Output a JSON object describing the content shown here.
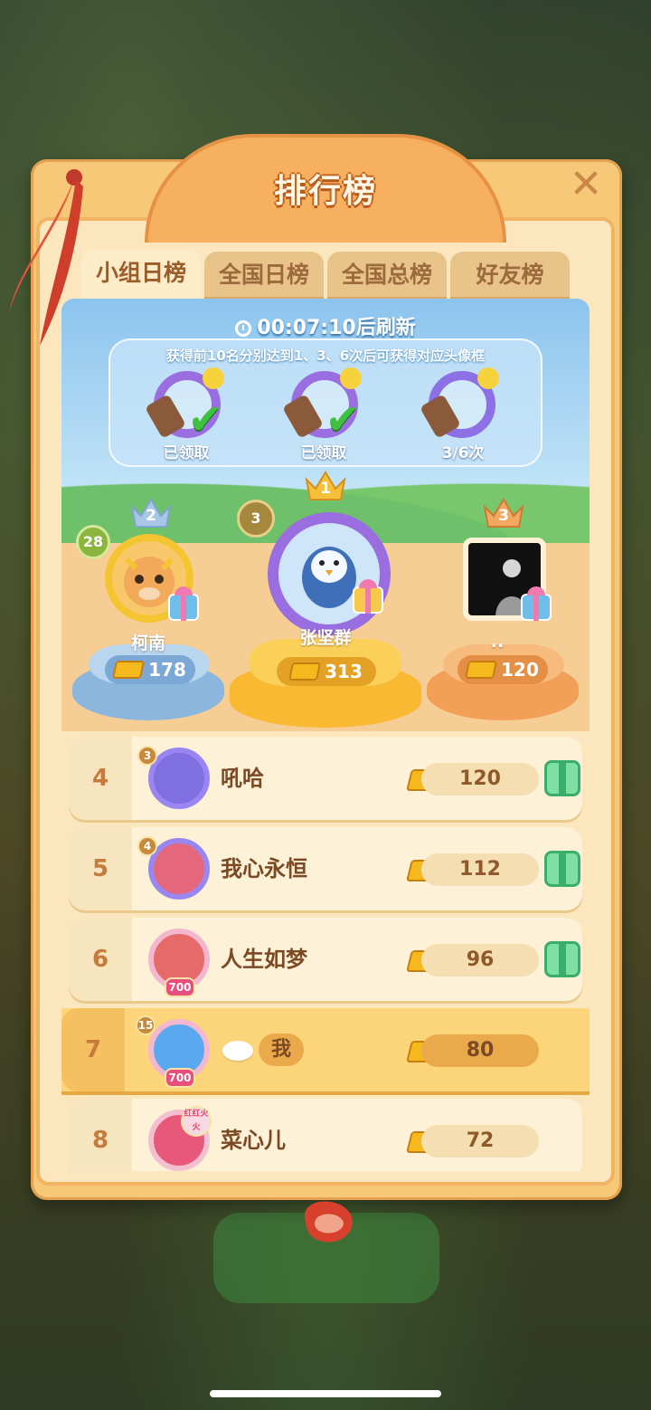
{
  "title": "排行榜",
  "tabs": [
    {
      "label": "小组日榜",
      "active": true
    },
    {
      "label": "全国日榜",
      "active": false
    },
    {
      "label": "全国总榜",
      "active": false
    },
    {
      "label": "好友榜",
      "active": false
    }
  ],
  "timer": {
    "countdown": "00:07:10",
    "suffix": "后刷新"
  },
  "reward_note": "获得前10名分别达到1、3、6次后可获得对应头像框",
  "rewards": [
    {
      "label": "已领取",
      "claimed": true
    },
    {
      "label": "已领取",
      "claimed": true
    },
    {
      "label": "3/6次",
      "claimed": false
    }
  ],
  "podium": [
    {
      "rank": "1",
      "name": "张坚群",
      "score": "313",
      "level": "3"
    },
    {
      "rank": "2",
      "name": "柯南",
      "score": "178",
      "level": "28"
    },
    {
      "rank": "3",
      "name": "..",
      "score": "120"
    }
  ],
  "list": [
    {
      "rank": "4",
      "name": "吼哈",
      "score": "120",
      "level": "3",
      "gift": true
    },
    {
      "rank": "5",
      "name": "我心永恒",
      "score": "112",
      "level": "4",
      "gift": true
    },
    {
      "rank": "6",
      "name": "人生如梦",
      "score": "96",
      "badge_text": "700",
      "gift": true
    },
    {
      "rank": "7",
      "name": "我",
      "score": "80",
      "level": "15",
      "badge_text": "700",
      "is_me": true
    },
    {
      "rank": "8",
      "name": "菜心儿",
      "score": "72",
      "badge_text": "红红火火"
    }
  ],
  "colors": {
    "accent": "#f6c878",
    "gold": "#f5b91e",
    "first": "#f9b933",
    "second": "#8bb7df",
    "third": "#f29f58"
  }
}
